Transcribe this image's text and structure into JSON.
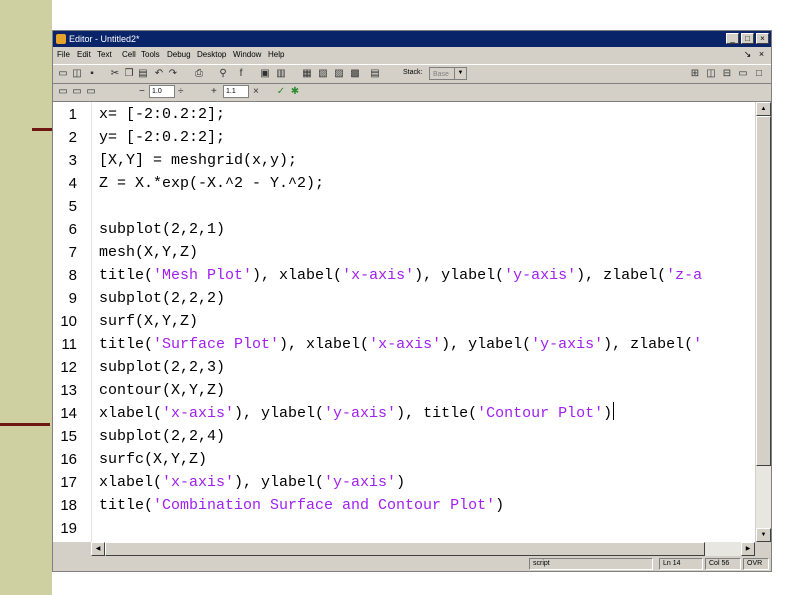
{
  "window": {
    "title": "Editor - Untitled2*"
  },
  "menu": [
    "File",
    "Edit",
    "Text",
    "Cell",
    "Tools",
    "Debug",
    "Desktop",
    "Window",
    "Help"
  ],
  "window_buttons": [
    "_",
    "□",
    "×"
  ],
  "mdi_buttons": [
    "↘",
    "×"
  ],
  "toolbar": {
    "icons": [
      "new-file-icon",
      "open-icon",
      "save-icon",
      "cut-icon",
      "copy-icon",
      "paste-icon",
      "undo-icon",
      "redo-icon",
      "print-icon",
      "find-icon",
      "function-icon",
      "clear-breakpoint-icon",
      "set-breakpoint-icon",
      "step-icon",
      "step-in-icon",
      "step-out-icon",
      "continue-icon",
      "exit-debug-icon"
    ],
    "stack_label": "Stack:",
    "stack_value": "Base",
    "layout_icons": [
      "tile-icon",
      "split-horizontal-icon",
      "split-vertical-icon",
      "float-icon"
    ]
  },
  "cellbar": {
    "minus": "−",
    "value1": "1.0",
    "divide": "÷",
    "plus": "+",
    "value2": "1.1",
    "times": "×"
  },
  "code_lines": [
    {
      "n": "1",
      "parts": [
        {
          "t": "x= [-2:0.2:2];",
          "s": false
        }
      ]
    },
    {
      "n": "2",
      "parts": [
        {
          "t": "y= [-2:0.2:2];",
          "s": false
        }
      ]
    },
    {
      "n": "3",
      "parts": [
        {
          "t": "[X,Y] = meshgrid(x,y);",
          "s": false
        }
      ]
    },
    {
      "n": "4",
      "parts": [
        {
          "t": "Z = X.*exp(-X.^2 - Y.^2);",
          "s": false
        }
      ]
    },
    {
      "n": "5",
      "parts": []
    },
    {
      "n": "6",
      "parts": [
        {
          "t": "subplot(2,2,1)",
          "s": false
        }
      ]
    },
    {
      "n": "7",
      "parts": [
        {
          "t": "mesh(X,Y,Z)",
          "s": false
        }
      ]
    },
    {
      "n": "8",
      "parts": [
        {
          "t": "title(",
          "s": false
        },
        {
          "t": "'Mesh Plot'",
          "s": true
        },
        {
          "t": "), xlabel(",
          "s": false
        },
        {
          "t": "'x-axis'",
          "s": true
        },
        {
          "t": "), ylabel(",
          "s": false
        },
        {
          "t": "'y-axis'",
          "s": true
        },
        {
          "t": "), zlabel(",
          "s": false
        },
        {
          "t": "'z-a",
          "s": true
        }
      ]
    },
    {
      "n": "9",
      "parts": [
        {
          "t": "subplot(2,2,2)",
          "s": false
        }
      ]
    },
    {
      "n": "10",
      "parts": [
        {
          "t": "surf(X,Y,Z)",
          "s": false
        }
      ]
    },
    {
      "n": "11",
      "parts": [
        {
          "t": "title(",
          "s": false
        },
        {
          "t": "'Surface Plot'",
          "s": true
        },
        {
          "t": "), xlabel(",
          "s": false
        },
        {
          "t": "'x-axis'",
          "s": true
        },
        {
          "t": "), ylabel(",
          "s": false
        },
        {
          "t": "'y-axis'",
          "s": true
        },
        {
          "t": "), zlabel(",
          "s": false
        },
        {
          "t": "'",
          "s": true
        }
      ]
    },
    {
      "n": "12",
      "parts": [
        {
          "t": "subplot(2,2,3)",
          "s": false
        }
      ]
    },
    {
      "n": "13",
      "parts": [
        {
          "t": "contour(X,Y,Z)",
          "s": false
        }
      ]
    },
    {
      "n": "14",
      "parts": [
        {
          "t": "xlabel(",
          "s": false
        },
        {
          "t": "'x-axis'",
          "s": true
        },
        {
          "t": "), ylabel(",
          "s": false
        },
        {
          "t": "'y-axis'",
          "s": true
        },
        {
          "t": "), title(",
          "s": false
        },
        {
          "t": "'Contour Plot'",
          "s": true
        },
        {
          "t": ")",
          "s": false
        }
      ],
      "caret": true
    },
    {
      "n": "15",
      "parts": [
        {
          "t": "subplot(2,2,4)",
          "s": false
        }
      ]
    },
    {
      "n": "16",
      "parts": [
        {
          "t": "surfc(X,Y,Z)",
          "s": false
        }
      ]
    },
    {
      "n": "17",
      "parts": [
        {
          "t": "xlabel(",
          "s": false
        },
        {
          "t": "'x-axis'",
          "s": true
        },
        {
          "t": "), ylabel(",
          "s": false
        },
        {
          "t": "'y-axis'",
          "s": true
        },
        {
          "t": ")",
          "s": false
        }
      ]
    },
    {
      "n": "18",
      "parts": [
        {
          "t": "title(",
          "s": false
        },
        {
          "t": "'Combination Surface and Contour Plot'",
          "s": true
        },
        {
          "t": ")",
          "s": false
        }
      ]
    },
    {
      "n": "19",
      "parts": []
    }
  ],
  "status": {
    "mode": "script",
    "line": "Ln  14",
    "col": "Col  56",
    "ovr": "OVR"
  },
  "colors": {
    "string": "#a020f0",
    "sidebar": "#cfd0a2",
    "rule": "#6e1612",
    "titlebar": "#0a246a"
  }
}
